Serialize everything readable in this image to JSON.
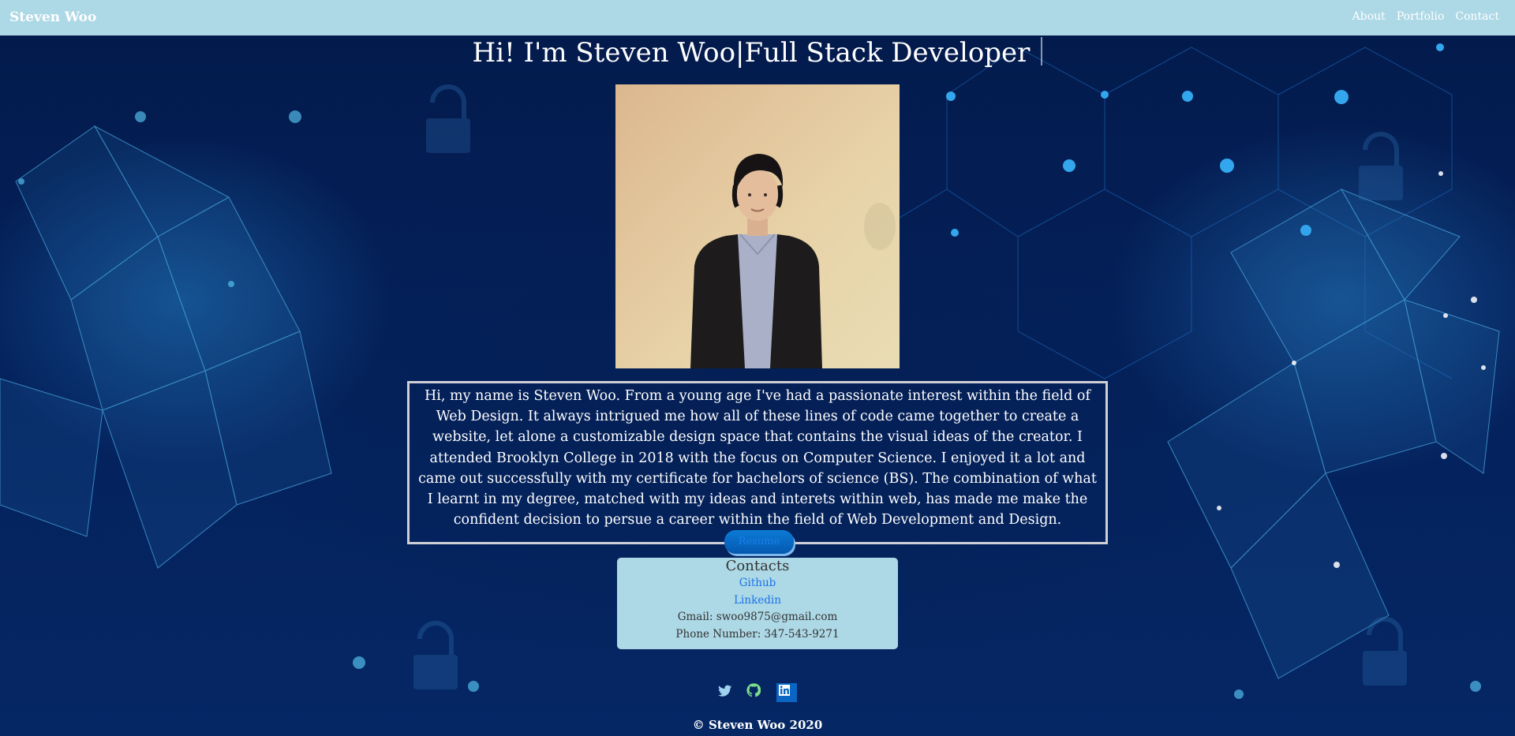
{
  "nav": {
    "brand": "Steven Woo",
    "links": [
      "About",
      "Portfolio",
      "Contact"
    ]
  },
  "hero": {
    "heading": "Hi! I'm Steven Woo|Full Stack Developer"
  },
  "about": {
    "text": "Hi, my name is Steven Woo. From a young age I've had a passionate interest within the field of Web Design. It always intrigued me how all of these lines of code came together to create a website, let alone a customizable design space that contains the visual ideas of the creator. I attended Brooklyn College in 2018 with the focus on Computer Science. I enjoyed it a lot and came out successfully with my certificate for bachelors of science (BS). The combination of what I learnt in my degree, matched with my ideas and interets within web, has made me make the confident decision to persue a career within the field of Web Development and Design.",
    "resume_label": "Resume"
  },
  "contacts": {
    "title": "Contacts",
    "github_label": "Github",
    "linkedin_label": "Linkedin",
    "gmail": "Gmail: swoo9875@gmail.com",
    "phone": "Phone Number: 347-543-9271"
  },
  "social_icons": [
    "twitter-icon",
    "github-icon",
    "linkedin-icon"
  ],
  "footer": {
    "copyright": "© Steven Woo 2020"
  },
  "colors": {
    "navbar": "#add8e6",
    "contacts_bg": "#add8e6",
    "background": "#031a4a",
    "link": "#1a73e8",
    "resume_button": "#0c7ad6"
  }
}
